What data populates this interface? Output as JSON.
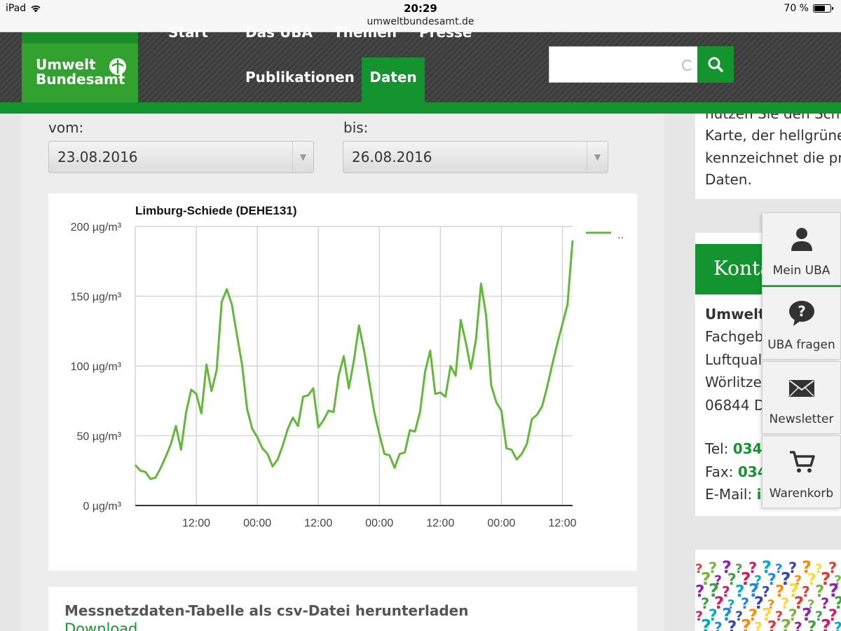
{
  "statusbar": {
    "device": "iPad",
    "time": "20:29",
    "url": "umweltbundesamt.de",
    "battery": "70 %",
    "battery_level": 0.7
  },
  "header": {
    "logo_line1": "Umwelt",
    "logo_line2": "Bundesamt",
    "nav_partial": [
      "Start",
      "Das UBA",
      "Themen",
      "Presse"
    ],
    "nav": [
      "Publikationen",
      "Daten"
    ],
    "active_nav": "Daten",
    "search_placeholder": ""
  },
  "form": {
    "from_label": "vom:",
    "from_value": "23.08.2016",
    "to_label": "bis:",
    "to_value": "26.08.2016"
  },
  "chart_data": {
    "type": "line",
    "title": "Limburg-Schiede (DEHE131)",
    "xlabel": "",
    "ylabel": "",
    "ylim": [
      0,
      200
    ],
    "yticks": [
      "0 µg/m³",
      "50 µg/m³",
      "100 µg/m³",
      "150 µg/m³",
      "200 µg/m³"
    ],
    "xticks": [
      {
        "label": "12:00",
        "hour": 12
      },
      {
        "label": "00:00",
        "hour": 24
      },
      {
        "label": "12:00",
        "hour": 36
      },
      {
        "label": "00:00",
        "hour": 48
      },
      {
        "label": "12:00",
        "hour": 60
      },
      {
        "label": "00:00",
        "hour": 72
      },
      {
        "label": "12:00",
        "hour": 84
      }
    ],
    "xlim": [
      0,
      86
    ],
    "grid": true,
    "legend": "top-right",
    "series": [
      {
        "name": "..",
        "color": "#63b83a",
        "x": [
          0,
          1,
          2,
          3,
          4,
          5,
          6,
          7,
          8,
          9,
          10,
          11,
          12,
          13,
          14,
          15,
          16,
          17,
          18,
          19,
          20,
          21,
          22,
          23,
          24,
          25,
          26,
          27,
          28,
          29,
          30,
          31,
          32,
          33,
          34,
          35,
          36,
          37,
          38,
          39,
          40,
          41,
          42,
          43,
          44,
          45,
          46,
          47,
          48,
          49,
          50,
          51,
          52,
          53,
          54,
          55,
          56,
          57,
          58,
          59,
          60,
          61,
          62,
          63,
          64,
          65,
          66,
          67,
          68,
          69,
          70,
          71,
          72,
          73,
          74,
          75,
          76,
          77,
          78,
          79,
          80,
          81,
          82,
          83,
          84,
          85,
          86
        ],
        "values": [
          29,
          25,
          24,
          19,
          20,
          27,
          35,
          44,
          57,
          40,
          67,
          83,
          80,
          66,
          101,
          82,
          97,
          146,
          155,
          144,
          122,
          101,
          69,
          55,
          49,
          41,
          37,
          28,
          33,
          43,
          55,
          63,
          57,
          78,
          79,
          84,
          56,
          61,
          68,
          67,
          93,
          107,
          84,
          104,
          129,
          111,
          89,
          67,
          51,
          37,
          36,
          27,
          37,
          38,
          54,
          53,
          67,
          96,
          111,
          80,
          81,
          78,
          100,
          93,
          133,
          117,
          98,
          119,
          159,
          136,
          86,
          74,
          68,
          41,
          40,
          33,
          37,
          44,
          62,
          65,
          71,
          85,
          101,
          116,
          130,
          144,
          190
        ]
      }
    ]
  },
  "download": {
    "title": "Messnetzdaten-Tabelle als csv-Datei herunterladen",
    "link": "Download"
  },
  "right_card1": {
    "lines": [
      "nutzen Sie den Sch",
      "Karte, der hellgrüne",
      "kennzeichnet die pr",
      "Daten."
    ]
  },
  "kontakt": {
    "heading": "Konta",
    "org": "Umweltb",
    "line1": "Fachgeb",
    "line2": "Luftqual",
    "line3": "Wörlitze",
    "line4": "06844 D",
    "tel_label": "Tel:",
    "tel_value": "034",
    "fax_label": "Fax:",
    "fax_value": "034",
    "email_label": "E-Mail:",
    "email_value": "i"
  },
  "side_panel": {
    "items": [
      "Mein UBA",
      "UBA fragen",
      "Newsletter",
      "Warenkorb"
    ]
  }
}
